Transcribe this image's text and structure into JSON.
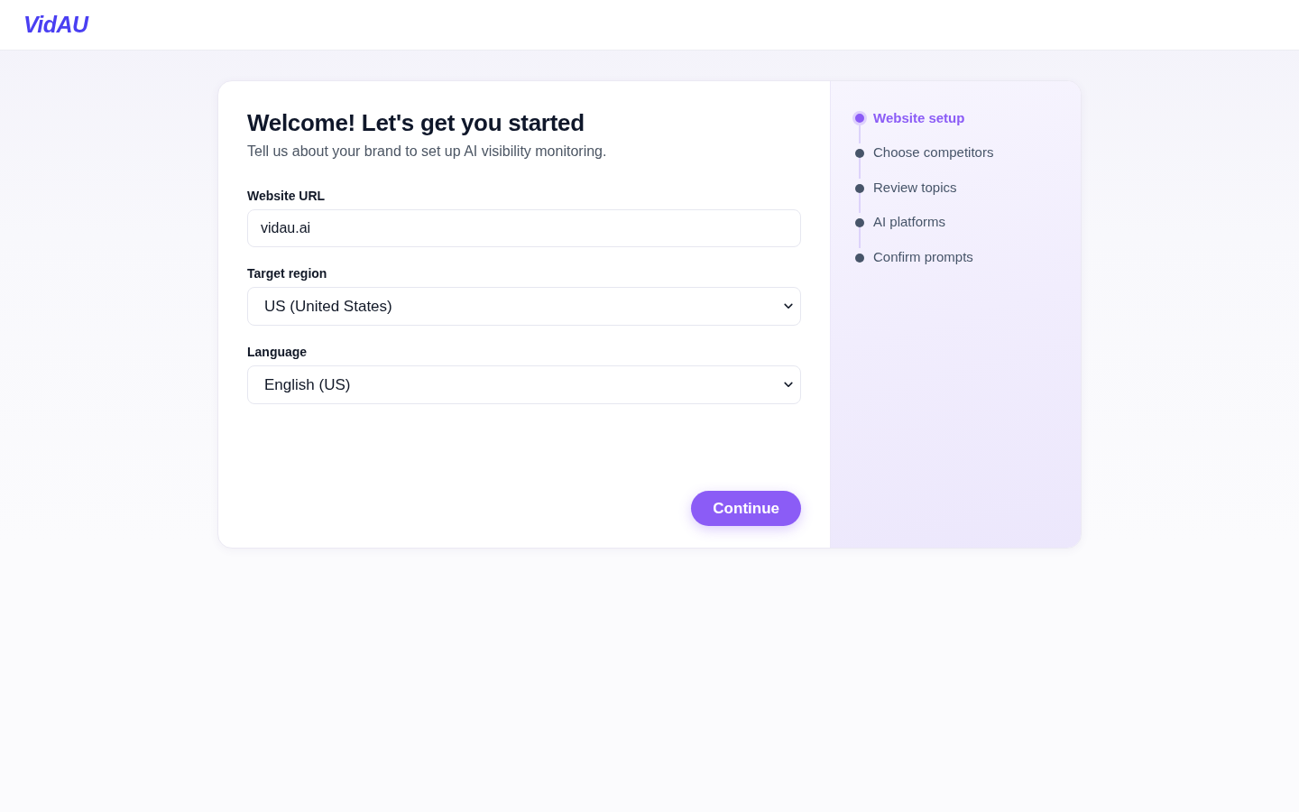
{
  "header": {
    "logo": "VidAU"
  },
  "form": {
    "title": "Welcome! Let's get you started",
    "subtitle": "Tell us about your brand to set up AI visibility monitoring.",
    "fields": [
      {
        "kind": "input",
        "label": "Website URL",
        "value": "vidau.ai"
      },
      {
        "kind": "select",
        "label": "Target region",
        "value": "US (United States)"
      },
      {
        "kind": "select",
        "label": "Language",
        "value": "English (US)"
      }
    ],
    "submit_button": "Continue"
  },
  "steps": [
    {
      "label": "Website setup",
      "selected": true
    },
    {
      "label": "Choose competitors",
      "selected": false
    },
    {
      "label": "Review topics",
      "selected": false
    },
    {
      "label": "AI platforms",
      "selected": false
    },
    {
      "label": "Confirm prompts",
      "selected": false
    }
  ]
}
